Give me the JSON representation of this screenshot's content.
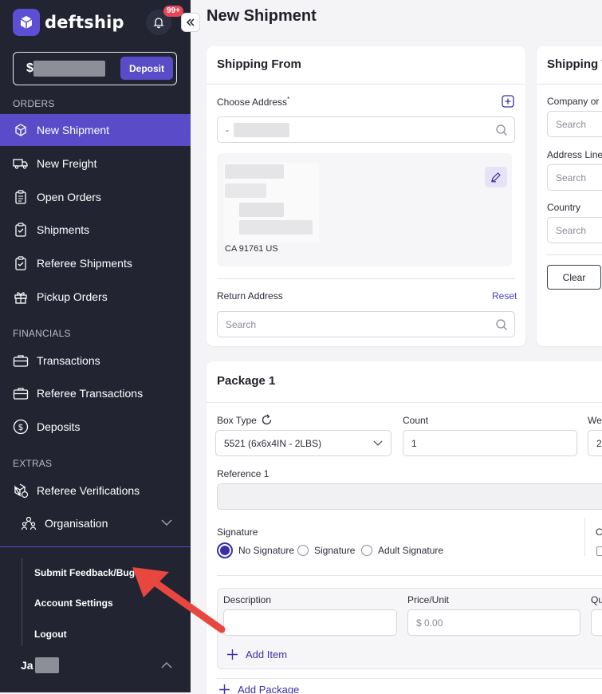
{
  "sidebar": {
    "logo_text": "deftship",
    "notifications_badge": "99+",
    "balance_prefix": "$",
    "deposit_label": "Deposit",
    "sections": {
      "orders": "ORDERS",
      "financials": "FINANCIALS",
      "extras": "EXTRAS"
    },
    "items": [
      {
        "label": "New Shipment",
        "icon": "cube-icon"
      },
      {
        "label": "New Freight",
        "icon": "truck-icon"
      },
      {
        "label": "Open Orders",
        "icon": "clipboard-icon"
      },
      {
        "label": "Shipments",
        "icon": "clipboard-check-icon"
      },
      {
        "label": "Referee Shipments",
        "icon": "clipboard-check-icon"
      },
      {
        "label": "Pickup Orders",
        "icon": "gift-icon"
      },
      {
        "label": "Transactions",
        "icon": "briefcase-icon"
      },
      {
        "label": "Referee Transactions",
        "icon": "briefcase-icon"
      },
      {
        "label": "Deposits",
        "icon": "dollar-circle-icon"
      },
      {
        "label": "Referee Verifications",
        "icon": "cube-check-icon"
      },
      {
        "label": "Organisation",
        "icon": "users-icon"
      }
    ],
    "submenu": [
      "Submit Feedback/Bug",
      "Account Settings",
      "Logout"
    ],
    "user_name": "Ja"
  },
  "main": {
    "title": "New Shipment",
    "shipping_from": {
      "title": "Shipping From",
      "choose_address_label": "Choose Address",
      "required_mark": "*",
      "address_line": "CA 91761 US",
      "return_address_label": "Return Address",
      "reset_label": "Reset",
      "return_placeholder": "Search"
    },
    "shipping_to": {
      "title": "Shipping T",
      "company_label": "Company or",
      "address_line_label": "Address Line",
      "country_label": "Country",
      "search_placeholder": "Search",
      "clear_label": "Clear"
    },
    "package": {
      "title": "Package 1",
      "box_type_label": "Box Type",
      "box_type_value": "5521 (6x6x4IN - 2LBS)",
      "count_label": "Count",
      "count_value": "1",
      "weight_label": "We",
      "weight_value": "2",
      "reference_label": "Reference 1",
      "signature_label": "Signature",
      "signature_options": [
        "No Signature",
        "Signature",
        "Adult Signature"
      ],
      "signature_selected": "No Signature",
      "side_label": "C",
      "description_label": "Description",
      "price_label": "Price/Unit",
      "price_placeholder": "$  0.00",
      "qty_label": "Qu",
      "add_item_label": "Add Item",
      "add_package_label": "Add Package"
    }
  },
  "colors": {
    "sidebar_bg": "#222432",
    "accent": "#5a4cc8",
    "badge": "#e8475a",
    "arrow": "#e8473f"
  }
}
